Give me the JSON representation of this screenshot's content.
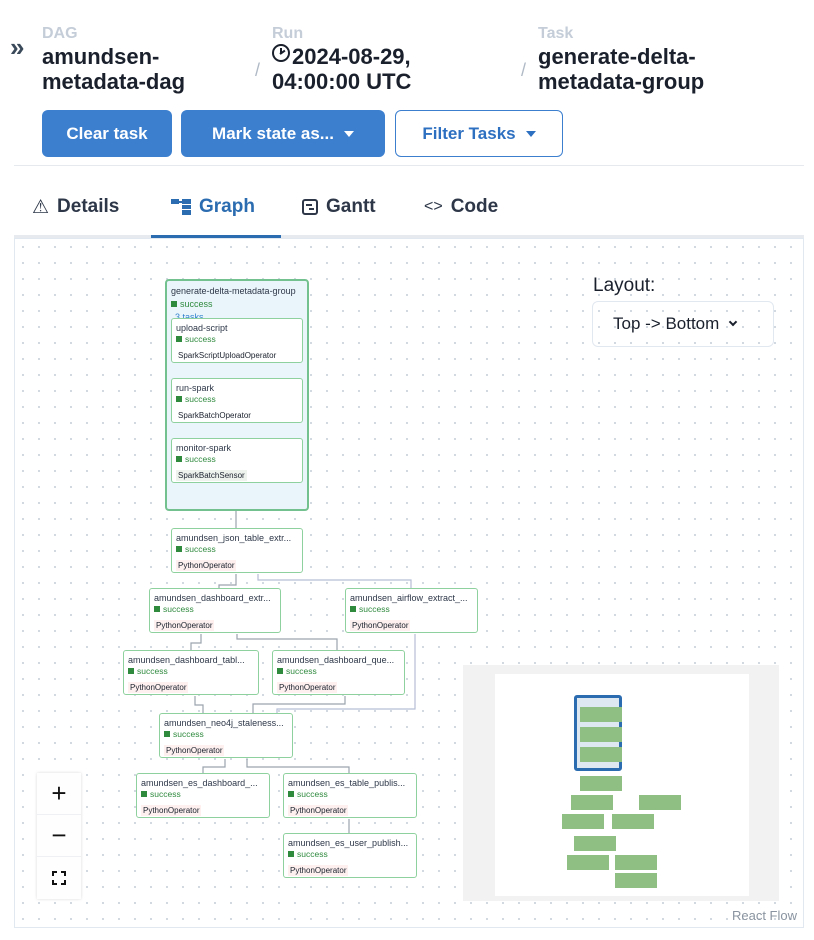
{
  "breadcrumb": {
    "dag_label": "DAG",
    "dag_line1": "amundsen-",
    "dag_line2": "metadata-dag",
    "run_label": "Run",
    "run_line1": "2024-08-29,",
    "run_line2": "04:00:00 UTC",
    "task_label": "Task",
    "task_line1": "generate-delta-",
    "task_line2": "metadata-group",
    "separator": "/"
  },
  "actions": {
    "clear_task": "Clear task",
    "mark_state": "Mark state as...",
    "filter_tasks": "Filter Tasks"
  },
  "tabs": [
    {
      "label": "Details"
    },
    {
      "label": "Graph"
    },
    {
      "label": "Gantt"
    },
    {
      "label": "Code"
    }
  ],
  "tab_icons": {
    "code": "<>",
    "warning": "⚠"
  },
  "group": {
    "title": "generate-delta-metadata-group",
    "state": "success",
    "count": "3 tasks"
  },
  "nodes": [
    {
      "title": "upload-script",
      "state": "success",
      "operator": "SparkScriptUploadOperator",
      "op_bg": "#ffffff"
    },
    {
      "title": "run-spark",
      "state": "success",
      "operator": "SparkBatchOperator",
      "op_bg": "#ffffff"
    },
    {
      "title": "monitor-spark",
      "state": "success",
      "operator": "SparkBatchSensor",
      "op_bg": "#eef3ee"
    },
    {
      "title": "amundsen_json_table_extr...",
      "state": "success",
      "operator": "PythonOperator",
      "op_bg": "#fdf0ef"
    },
    {
      "title": "amundsen_dashboard_extr...",
      "state": "success",
      "operator": "PythonOperator",
      "op_bg": "#fdf0ef"
    },
    {
      "title": "amundsen_airflow_extract_...",
      "state": "success",
      "operator": "PythonOperator",
      "op_bg": "#fdf0ef"
    },
    {
      "title": "amundsen_dashboard_tabl...",
      "state": "success",
      "operator": "PythonOperator",
      "op_bg": "#fdf0ef"
    },
    {
      "title": "amundsen_dashboard_que...",
      "state": "success",
      "operator": "PythonOperator",
      "op_bg": "#fdf0ef"
    },
    {
      "title": "amundsen_neo4j_staleness...",
      "state": "success",
      "operator": "PythonOperator",
      "op_bg": "#fdf0ef"
    },
    {
      "title": "amundsen_es_dashboard_...",
      "state": "success",
      "operator": "PythonOperator",
      "op_bg": "#fdf0ef"
    },
    {
      "title": "amundsen_es_table_publis...",
      "state": "success",
      "operator": "PythonOperator",
      "op_bg": "#fdf0ef"
    },
    {
      "title": "amundsen_es_user_publish...",
      "state": "success",
      "operator": "PythonOperator",
      "op_bg": "#fdf0ef"
    }
  ],
  "layout": {
    "label": "Layout:",
    "selected": "Top -> Bottom"
  },
  "zoom": {
    "in": "+",
    "out": "−"
  },
  "attribution": "React Flow",
  "colors": {
    "primary": "#3c7fcf",
    "success": "#2f8a3e",
    "node_border": "#8fd19e",
    "group_fill": "#eaf5fb"
  }
}
